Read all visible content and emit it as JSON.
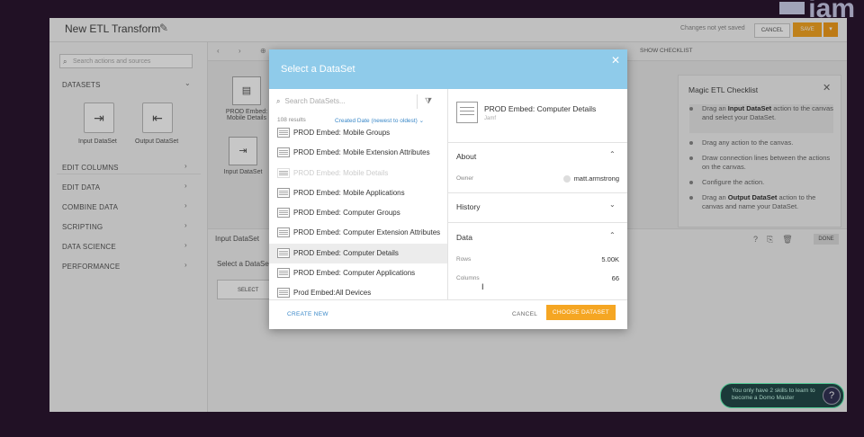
{
  "app": {
    "title": "New ETL Transform",
    "unsaved_text": "Changes not yet saved",
    "cancel_label": "CANCEL",
    "save_label": "SAVE",
    "brand": "iam"
  },
  "sidebar": {
    "search_placeholder": "Search actions and sources",
    "sections": [
      "DATASETS",
      "EDIT COLUMNS",
      "EDIT DATA",
      "COMBINE DATA",
      "SCRIPTING",
      "DATA SCIENCE",
      "PERFORMANCE"
    ],
    "tiles": [
      "Input DataSet",
      "Output DataSet"
    ]
  },
  "canvas": {
    "show_checklist": "SHOW CHECKLIST",
    "node_label_1": "PROD Embed: Mobile Details",
    "node_label_2": "Input DataSet",
    "lower_head": "Input DataSet",
    "lower_sub": "Select a DataSet",
    "lower_select": "SELECT",
    "done_label": "DONE"
  },
  "checklist": {
    "title": "Magic ETL Checklist",
    "items": [
      {
        "pre": "Drag an ",
        "bold": "Input DataSet",
        "post": " action to the canvas and select your DataSet."
      },
      {
        "pre": "Drag any action to the canvas.",
        "bold": "",
        "post": ""
      },
      {
        "pre": "Draw connection lines between the actions on the canvas.",
        "bold": "",
        "post": ""
      },
      {
        "pre": "Configure the action.",
        "bold": "",
        "post": ""
      },
      {
        "pre": "Drag an ",
        "bold": "Output DataSet",
        "post": " action to the canvas and name your DataSet."
      }
    ]
  },
  "help": {
    "text": "You only have 2 skills to learn to become a Domo Master",
    "q": "?"
  },
  "modal": {
    "title": "Select a DataSet",
    "search_placeholder": "Search DataSets...",
    "results_count": "108 results",
    "sort_label": "Created Date (newest to oldest)",
    "datasets": [
      {
        "name": "PROD Embed: Mobile Groups",
        "state": ""
      },
      {
        "name": "PROD Embed: Mobile Extension Attributes",
        "state": ""
      },
      {
        "name": "PROD Embed: Mobile Details",
        "state": "dim"
      },
      {
        "name": "PROD Embed: Mobile Applications",
        "state": ""
      },
      {
        "name": "PROD Embed: Computer Groups",
        "state": ""
      },
      {
        "name": "PROD Embed: Computer Extension Attributes",
        "state": ""
      },
      {
        "name": "PROD Embed: Computer Details",
        "state": "sel"
      },
      {
        "name": "PROD Embed: Computer Applications",
        "state": ""
      },
      {
        "name": "Prod Embed:All Devices",
        "state": ""
      }
    ],
    "detail": {
      "title": "PROD Embed: Computer Details",
      "type": "Jamf",
      "about_label": "About",
      "owner_key": "Owner",
      "owner_value": "matt.armstrong",
      "history_label": "History",
      "data_label": "Data",
      "rows_key": "Rows",
      "rows_value": "5.00K",
      "columns_key": "Columns",
      "columns_value": "66"
    },
    "create_new": "CREATE NEW",
    "cancel": "CANCEL",
    "choose": "CHOOSE DATASET"
  }
}
